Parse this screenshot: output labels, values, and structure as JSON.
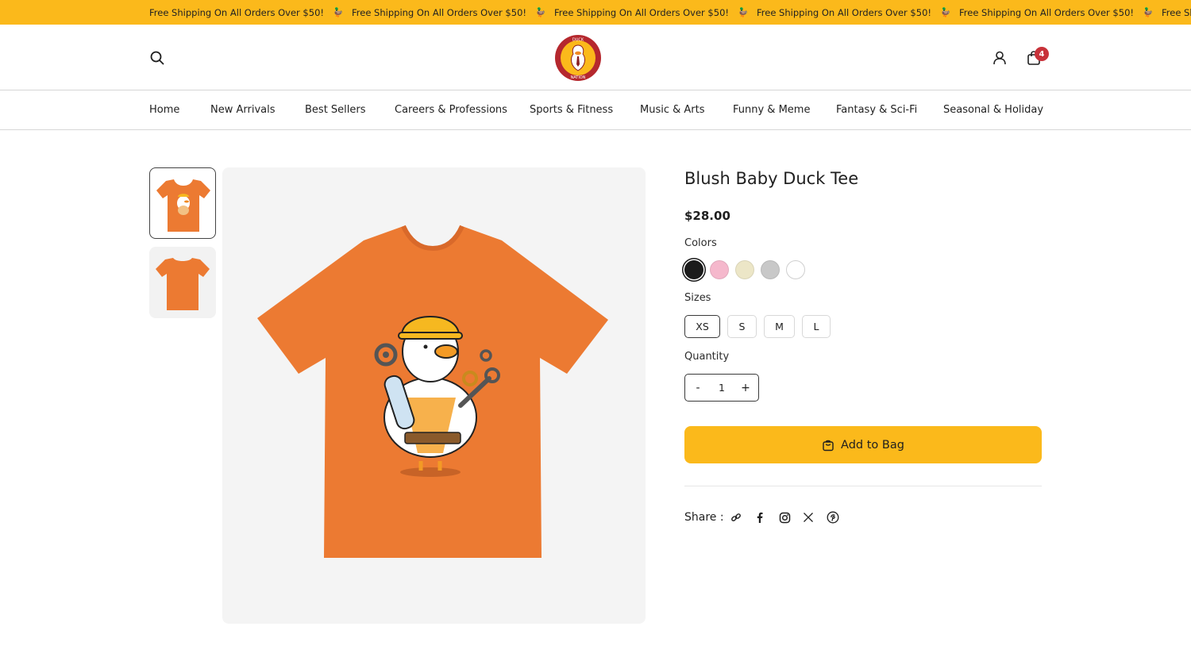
{
  "announcement": {
    "text": "Free Shipping On All Orders Over $50!",
    "separator": "🦆",
    "repeats": [
      "Free Shipping On All Orders Over $50!",
      "Free Shipping On All Orders Over $50!",
      "Free Shipping On All Orders Over $50!",
      "Free Shipping On All Orders Over $50!",
      "Free Shipping On All Orders Over $50!",
      "Free Shipping On All Orders Over"
    ]
  },
  "header": {
    "logo_top": "DUCK",
    "logo_bottom": "NATION",
    "cart_count": "4"
  },
  "nav": {
    "items": [
      "Home",
      "New Arrivals",
      "Best Sellers",
      "Careers & Professions",
      "Sports & Fitness",
      "Music & Arts",
      "Funny & Meme",
      "Fantasy & Sci-Fi",
      "Seasonal & Holiday"
    ]
  },
  "product": {
    "title": "Blush Baby Duck Tee",
    "price": "$28.00",
    "colors_label": "Colors",
    "colors": [
      "#1b1b1b",
      "#f5b8cc",
      "#ece6c7",
      "#c8c8c8",
      "#ffffff"
    ],
    "selected_color_index": 0,
    "sizes_label": "Sizes",
    "sizes": [
      "XS",
      "S",
      "M",
      "L"
    ],
    "selected_size": "XS",
    "quantity_label": "Quantity",
    "quantity": "1",
    "qty_minus": "-",
    "qty_plus": "+",
    "add_to_bag": "Add to Bag",
    "share_label": "Share :",
    "share_icons": [
      "link-icon",
      "facebook-icon",
      "instagram-icon",
      "x-icon",
      "pinterest-icon"
    ],
    "shirt_color": "#ec7a32",
    "accent": "#fbb91b"
  }
}
